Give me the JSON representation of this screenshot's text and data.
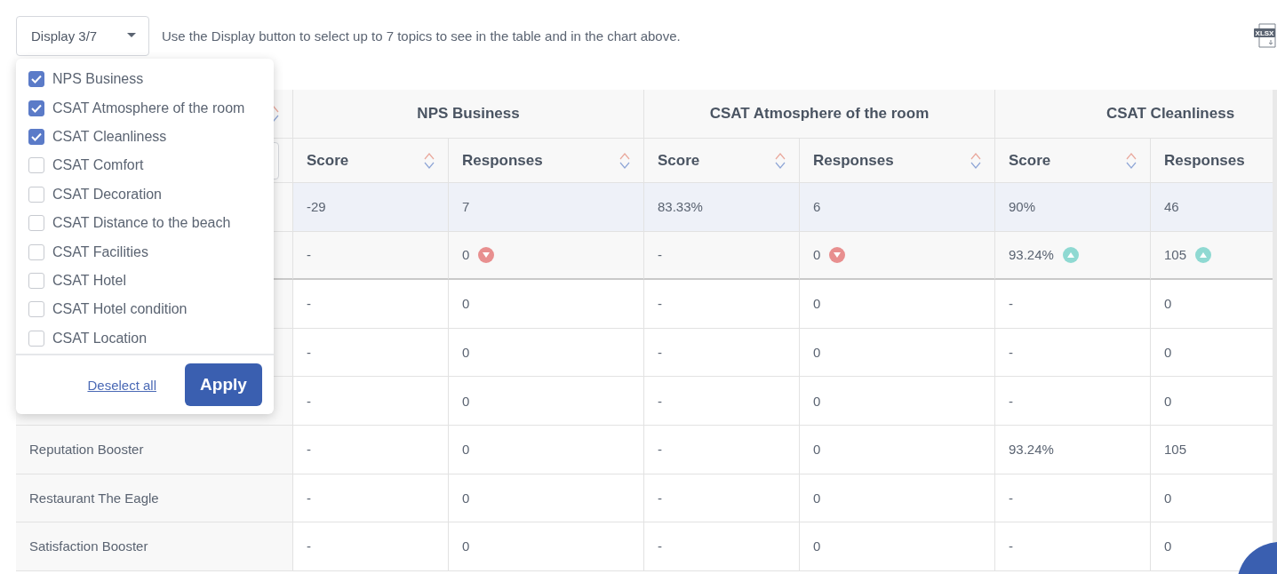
{
  "toolbar": {
    "display_button": "Display 3/7",
    "hint": "Use the Display button to select up to 7 topics to see in the table and in the chart above.",
    "export_label": "XLSX"
  },
  "topic_menu": {
    "topics": [
      {
        "label": "NPS Business",
        "checked": true
      },
      {
        "label": "CSAT Atmosphere of the room",
        "checked": true
      },
      {
        "label": "CSAT Cleanliness",
        "checked": true
      },
      {
        "label": "CSAT Comfort",
        "checked": false
      },
      {
        "label": "CSAT Decoration",
        "checked": false
      },
      {
        "label": "CSAT Distance to the beach",
        "checked": false
      },
      {
        "label": "CSAT Facilities",
        "checked": false
      },
      {
        "label": "CSAT Hotel",
        "checked": false
      },
      {
        "label": "CSAT Hotel condition",
        "checked": false
      },
      {
        "label": "CSAT Location",
        "checked": false
      }
    ],
    "deselect_link": "Deselect all",
    "apply_button": "Apply"
  },
  "table": {
    "groups": [
      {
        "title": "NPS Business",
        "columns": [
          "Score",
          "Responses"
        ]
      },
      {
        "title": "CSAT Atmosphere of the room",
        "columns": [
          "Score",
          "Responses"
        ]
      },
      {
        "title": "CSAT Cleanliness",
        "columns": [
          "Score",
          "Responses"
        ]
      }
    ],
    "rows": [
      {
        "kind": "current",
        "cells": [
          {
            "text": "-29",
            "kind": "plain"
          },
          {
            "text": "7",
            "kind": "plain"
          },
          {
            "text": "83.33%",
            "kind": "plain"
          },
          {
            "text": "6",
            "kind": "plain"
          },
          {
            "text": "90%",
            "kind": "plain"
          },
          {
            "text": "46",
            "kind": "plain"
          }
        ]
      },
      {
        "kind": "comparison",
        "cells": [
          {
            "text": "-",
            "kind": "plain"
          },
          {
            "text": "0",
            "kind": "decrease"
          },
          {
            "text": "-",
            "kind": "plain"
          },
          {
            "text": "0",
            "kind": "decrease"
          },
          {
            "text": "93.24%",
            "kind": "increase"
          },
          {
            "text": "105",
            "kind": "increase"
          }
        ]
      },
      {
        "kind": "item",
        "cells": [
          {
            "text": "-",
            "kind": "plain"
          },
          {
            "text": "0",
            "kind": "plain"
          },
          {
            "text": "-",
            "kind": "plain"
          },
          {
            "text": "0",
            "kind": "plain"
          },
          {
            "text": "-",
            "kind": "plain"
          },
          {
            "text": "0",
            "kind": "plain"
          }
        ]
      },
      {
        "kind": "item",
        "cells": [
          {
            "text": "-",
            "kind": "plain"
          },
          {
            "text": "0",
            "kind": "plain"
          },
          {
            "text": "-",
            "kind": "plain"
          },
          {
            "text": "0",
            "kind": "plain"
          },
          {
            "text": "-",
            "kind": "plain"
          },
          {
            "text": "0",
            "kind": "plain"
          }
        ]
      },
      {
        "kind": "item",
        "cells": [
          {
            "text": "-",
            "kind": "plain"
          },
          {
            "text": "0",
            "kind": "plain"
          },
          {
            "text": "-",
            "kind": "plain"
          },
          {
            "text": "0",
            "kind": "plain"
          },
          {
            "text": "-",
            "kind": "plain"
          },
          {
            "text": "0",
            "kind": "plain"
          }
        ]
      },
      {
        "kind": "item",
        "label": "Reputation Booster",
        "cells": [
          {
            "text": "-",
            "kind": "plain"
          },
          {
            "text": "0",
            "kind": "plain"
          },
          {
            "text": "-",
            "kind": "plain"
          },
          {
            "text": "0",
            "kind": "plain"
          },
          {
            "text": "93.24%",
            "kind": "plain"
          },
          {
            "text": "105",
            "kind": "plain"
          }
        ]
      },
      {
        "kind": "item",
        "label": "Restaurant The Eagle",
        "cells": [
          {
            "text": "-",
            "kind": "plain"
          },
          {
            "text": "0",
            "kind": "plain"
          },
          {
            "text": "-",
            "kind": "plain"
          },
          {
            "text": "0",
            "kind": "plain"
          },
          {
            "text": "-",
            "kind": "plain"
          },
          {
            "text": "0",
            "kind": "plain"
          }
        ]
      },
      {
        "kind": "item",
        "label": "Satisfaction Booster",
        "cells": [
          {
            "text": "-",
            "kind": "plain"
          },
          {
            "text": "0",
            "kind": "plain"
          },
          {
            "text": "-",
            "kind": "plain"
          },
          {
            "text": "0",
            "kind": "plain"
          },
          {
            "text": "-",
            "kind": "plain"
          },
          {
            "text": "0",
            "kind": "plain"
          }
        ]
      }
    ]
  }
}
